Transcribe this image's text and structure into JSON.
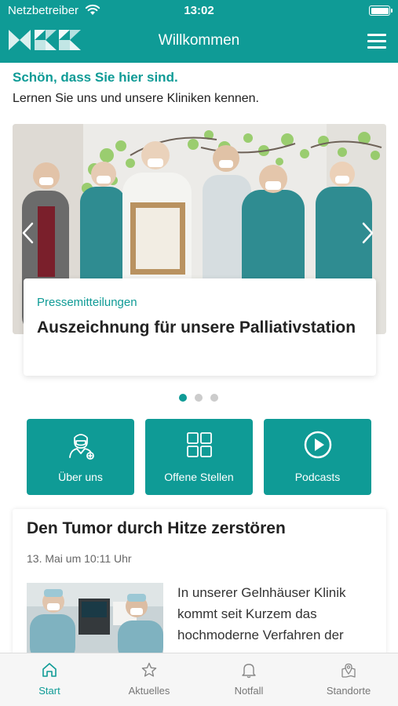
{
  "status_bar": {
    "carrier": "Netzbetreiber",
    "time": "13:02"
  },
  "header": {
    "title": "Willkommen",
    "brand_color": "#0f9b96"
  },
  "welcome": {
    "greeting": "Schön, dass Sie hier sind.",
    "intro": "Lernen Sie uns und unsere Kliniken kennen."
  },
  "carousel": {
    "current_index": 1,
    "total": 3,
    "slide": {
      "category": "Pressemitteilungen",
      "title": "Auszeichnung für unsere Palliativstation"
    }
  },
  "quick_links": [
    {
      "label": "Über uns",
      "icon": "doctor-icon"
    },
    {
      "label": "Offene Stellen",
      "icon": "grid-icon"
    },
    {
      "label": "Podcasts",
      "icon": "play-icon"
    }
  ],
  "article": {
    "title": "Den Tumor durch Hitze zerstören",
    "date": "13. Mai um 10:11 Uhr",
    "excerpt": "In unserer Gelnhäuser Klinik kommt seit Kurzem das hochmoderne Verfahren der"
  },
  "tabbar": [
    {
      "label": "Start",
      "icon": "home-icon",
      "active": true
    },
    {
      "label": "Aktuelles",
      "icon": "star-icon",
      "active": false
    },
    {
      "label": "Notfall",
      "icon": "bell-icon",
      "active": false
    },
    {
      "label": "Standorte",
      "icon": "map-pin-icon",
      "active": false
    }
  ]
}
